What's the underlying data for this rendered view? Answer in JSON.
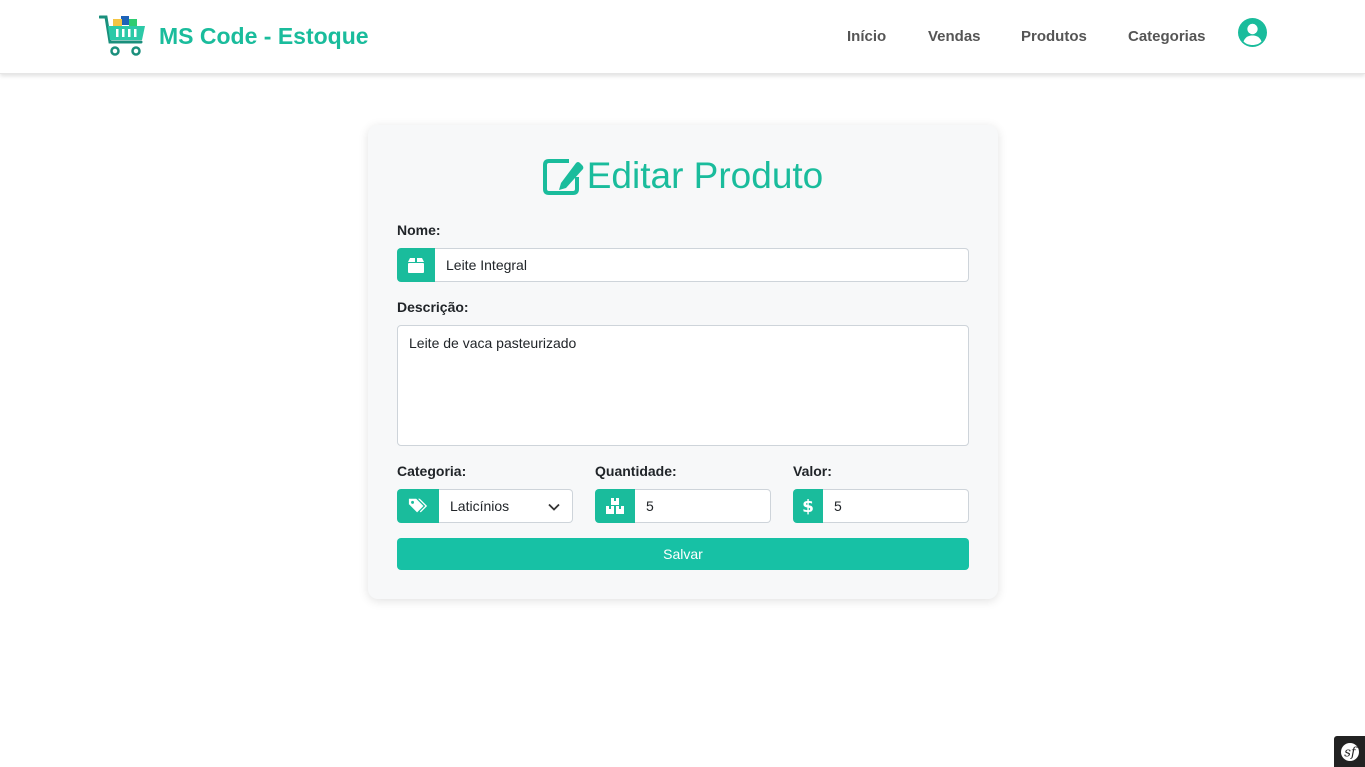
{
  "header": {
    "brand": "MS Code - Estoque",
    "nav": [
      {
        "label": "Início"
      },
      {
        "label": "Vendas"
      },
      {
        "label": "Produtos"
      },
      {
        "label": "Categorias"
      }
    ],
    "icons": {
      "logo": "shopping-cart-icon",
      "user": "user-circle-icon"
    }
  },
  "form": {
    "title": "Editar Produto",
    "title_icon": "edit-icon",
    "nome": {
      "label": "Nome:",
      "value": "Leite Integral",
      "icon": "box-icon"
    },
    "descricao": {
      "label": "Descrição:",
      "value": "Leite de vaca pasteurizado"
    },
    "categoria": {
      "label": "Categoria:",
      "value": "Laticínios",
      "icon": "tags-icon"
    },
    "quantidade": {
      "label": "Quantidade:",
      "value": "5",
      "icon": "boxes-icon"
    },
    "valor": {
      "label": "Valor:",
      "value": "5",
      "icon": "dollar-icon"
    },
    "save_label": "Salvar"
  },
  "colors": {
    "accent": "#1abc9c",
    "button": "#17c1a5"
  }
}
